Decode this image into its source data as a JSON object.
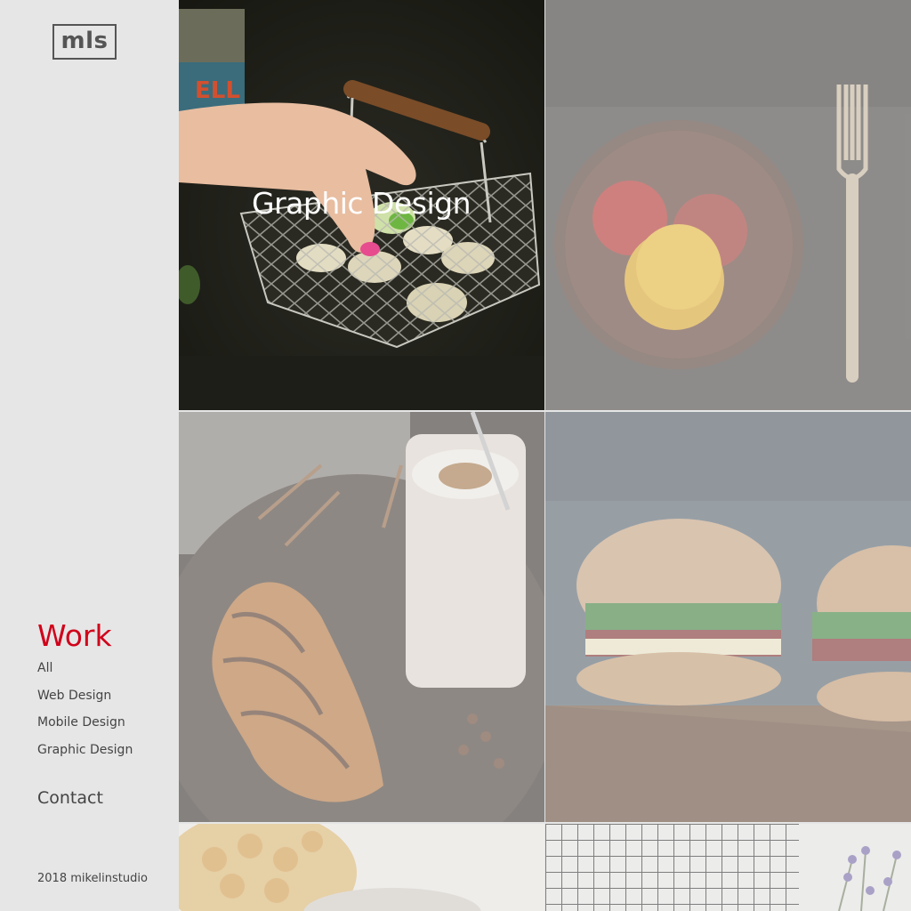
{
  "brand": {
    "logo_text": "mls"
  },
  "nav": {
    "heading": "Work",
    "items": [
      {
        "label": "All"
      },
      {
        "label": "Web Design"
      },
      {
        "label": "Mobile Design"
      },
      {
        "label": "Graphic Design"
      }
    ],
    "contact": "Contact"
  },
  "footer": {
    "copyright": "2018 mikelinstudio"
  },
  "gallery": {
    "hover_label": "Graphic Design"
  },
  "colors": {
    "accent": "#d0021b",
    "sidebar_bg": "#e6e6e6",
    "text": "#444444"
  }
}
